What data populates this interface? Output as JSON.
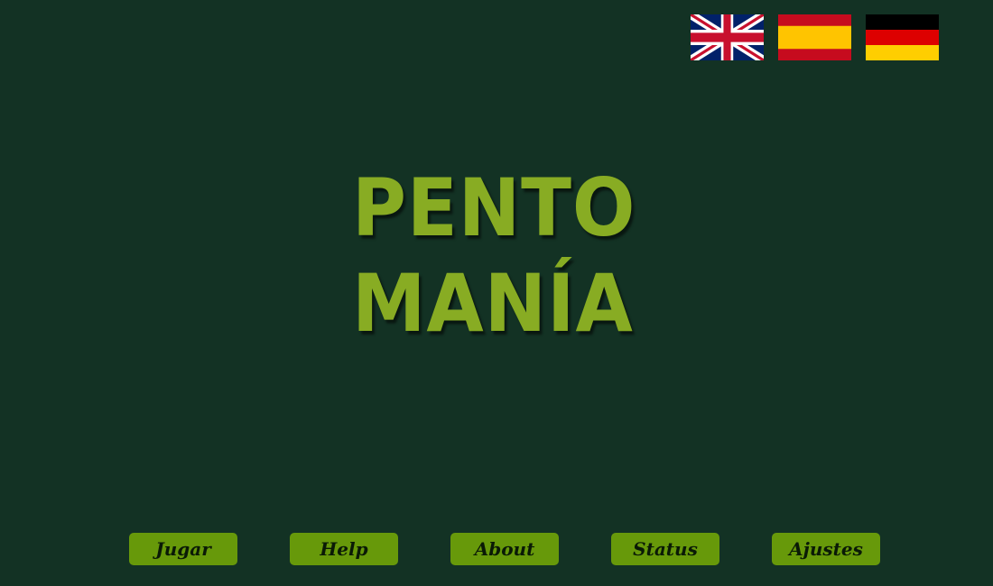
{
  "app": {
    "title_line_1": "PENTO",
    "title_line_2": "MANÍA",
    "title_color": "#88ac23",
    "background_color": "#133224"
  },
  "languages": [
    {
      "code": "en",
      "name": "English",
      "flag": "uk-flag-icon"
    },
    {
      "code": "es",
      "name": "Español",
      "flag": "spain-flag-icon"
    },
    {
      "code": "de",
      "name": "Deutsch",
      "flag": "germany-flag-icon"
    }
  ],
  "menu": {
    "button_color": "#67990a",
    "items": [
      {
        "label": "Jugar"
      },
      {
        "label": "Help"
      },
      {
        "label": "About"
      },
      {
        "label": "Status"
      },
      {
        "label": "Ajustes"
      }
    ]
  }
}
